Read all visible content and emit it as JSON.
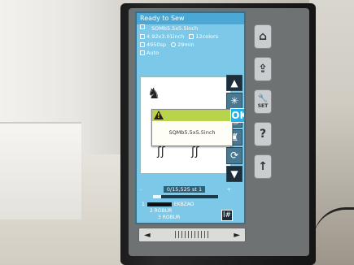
{
  "screen": {
    "status_title": "Ready to Sew",
    "info": {
      "pattern_name": "SOMb5.5x5.5inch",
      "size": "4.92x3.01inch",
      "colors": "12colors",
      "stitch_count": "4950sp",
      "time": "29min"
    },
    "mode": "Auto",
    "dialog": {
      "message": "SQMb5.5x5.5inch",
      "ok_label": "OK"
    },
    "stepper": {
      "minus": "-",
      "value": "0/15,525 st 1",
      "plus": "+"
    },
    "progress_fraction": 0.12,
    "threads": [
      {
        "index": "1",
        "name": "EKBZAO"
      },
      {
        "index": "2",
        "name": "ROBUR"
      },
      {
        "index": "3",
        "name": "ROBUR"
      }
    ],
    "thread_button": "l#"
  },
  "nav_bar": {
    "left": "◄",
    "ticks": "|||||||||||",
    "right": "►"
  },
  "hardware_buttons": [
    {
      "icon": "home-icon",
      "label": "⌂"
    },
    {
      "icon": "folder-icon",
      "label": "⇪"
    },
    {
      "icon": "wrench-icon",
      "label": "🔧",
      "sub": "SET"
    },
    {
      "icon": "help-icon",
      "label": "?"
    },
    {
      "icon": "needle-icon",
      "label": "↑"
    }
  ]
}
